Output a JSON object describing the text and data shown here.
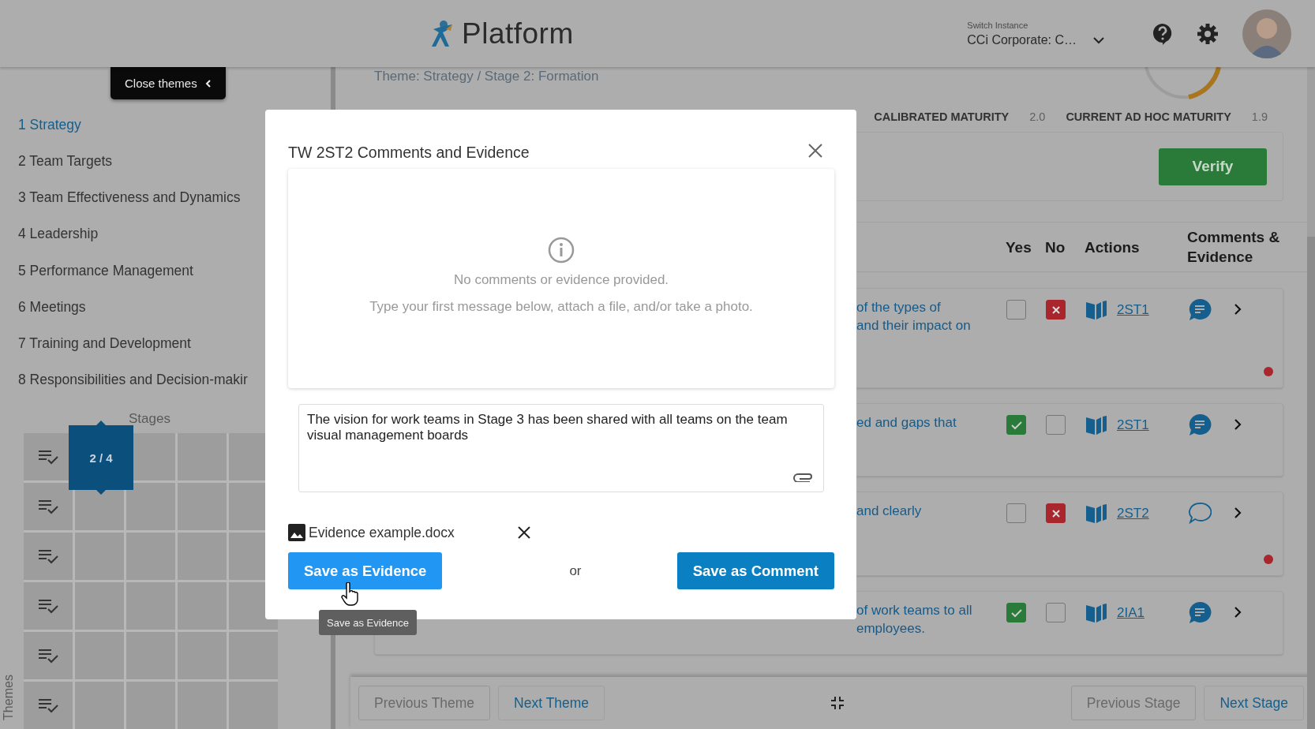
{
  "header": {
    "brand": "Platform",
    "instance_label": "Switch Instance",
    "instance_value": "CCi Corporate: C…"
  },
  "sidebar": {
    "close_button": "Close themes",
    "themes": [
      {
        "label": "1 Strategy",
        "selected": true
      },
      {
        "label": "2 Team Targets",
        "selected": false
      },
      {
        "label": "3 Team Effectiveness and Dynamics",
        "selected": false
      },
      {
        "label": "4 Leadership",
        "selected": false
      },
      {
        "label": "5 Performance Management",
        "selected": false
      },
      {
        "label": "6 Meetings",
        "selected": false
      },
      {
        "label": "7 Training and Development",
        "selected": false
      },
      {
        "label": "8 Responsibilities and Decision-makir",
        "selected": false
      }
    ],
    "stages_label": "Stages",
    "axis_label": "Themes",
    "marker": "2 / 4"
  },
  "main": {
    "breadcrumb": "Theme: Strategy / Stage 2: Formation",
    "maturity": [
      {
        "label": "CALIBRATED MATURITY",
        "value": "2.0"
      },
      {
        "label": "CURRENT AD HOC MATURITY",
        "value": "1.9"
      }
    ],
    "verify_button": "Verify",
    "columns": [
      "Yes",
      "No",
      "Actions",
      "Comments & Evidence"
    ],
    "rows": [
      {
        "lines": [
          "of the types of",
          "and their impact on"
        ],
        "yes": false,
        "no": true,
        "code": "2ST1",
        "has_comments": true,
        "flagged": true
      },
      {
        "lines": [
          "ed and gaps that"
        ],
        "yes": true,
        "no": false,
        "code": "2ST1",
        "has_comments": true,
        "flagged": false
      },
      {
        "lines": [
          "and clearly"
        ],
        "yes": false,
        "no": true,
        "code": "2ST2",
        "has_comments": false,
        "flagged": true
      },
      {
        "lines": [
          "of work teams to all",
          "employees."
        ],
        "yes": true,
        "no": false,
        "code": "2IA1",
        "has_comments": true,
        "flagged": false
      }
    ]
  },
  "footer": {
    "theme_buttons": [
      {
        "label": "Previous Theme",
        "disabled": true
      },
      {
        "label": "Next Theme",
        "disabled": false
      }
    ],
    "stage_buttons": [
      {
        "label": "Previous Stage",
        "disabled": true
      },
      {
        "label": "Next Stage",
        "disabled": false
      }
    ]
  },
  "modal": {
    "title": "TW 2ST2 Comments and Evidence",
    "empty_title": "No comments or evidence provided.",
    "empty_hint": "Type your first message below, attach a file, and/or take a photo.",
    "message": "The vision for work teams in Stage 3 has been shared with all teams on the team visual management boards",
    "attachment": "Evidence example.docx",
    "evidence_button": "Save as Evidence",
    "or_label": "or",
    "comment_button": "Save as Comment",
    "tooltip": "Save as Evidence"
  }
}
